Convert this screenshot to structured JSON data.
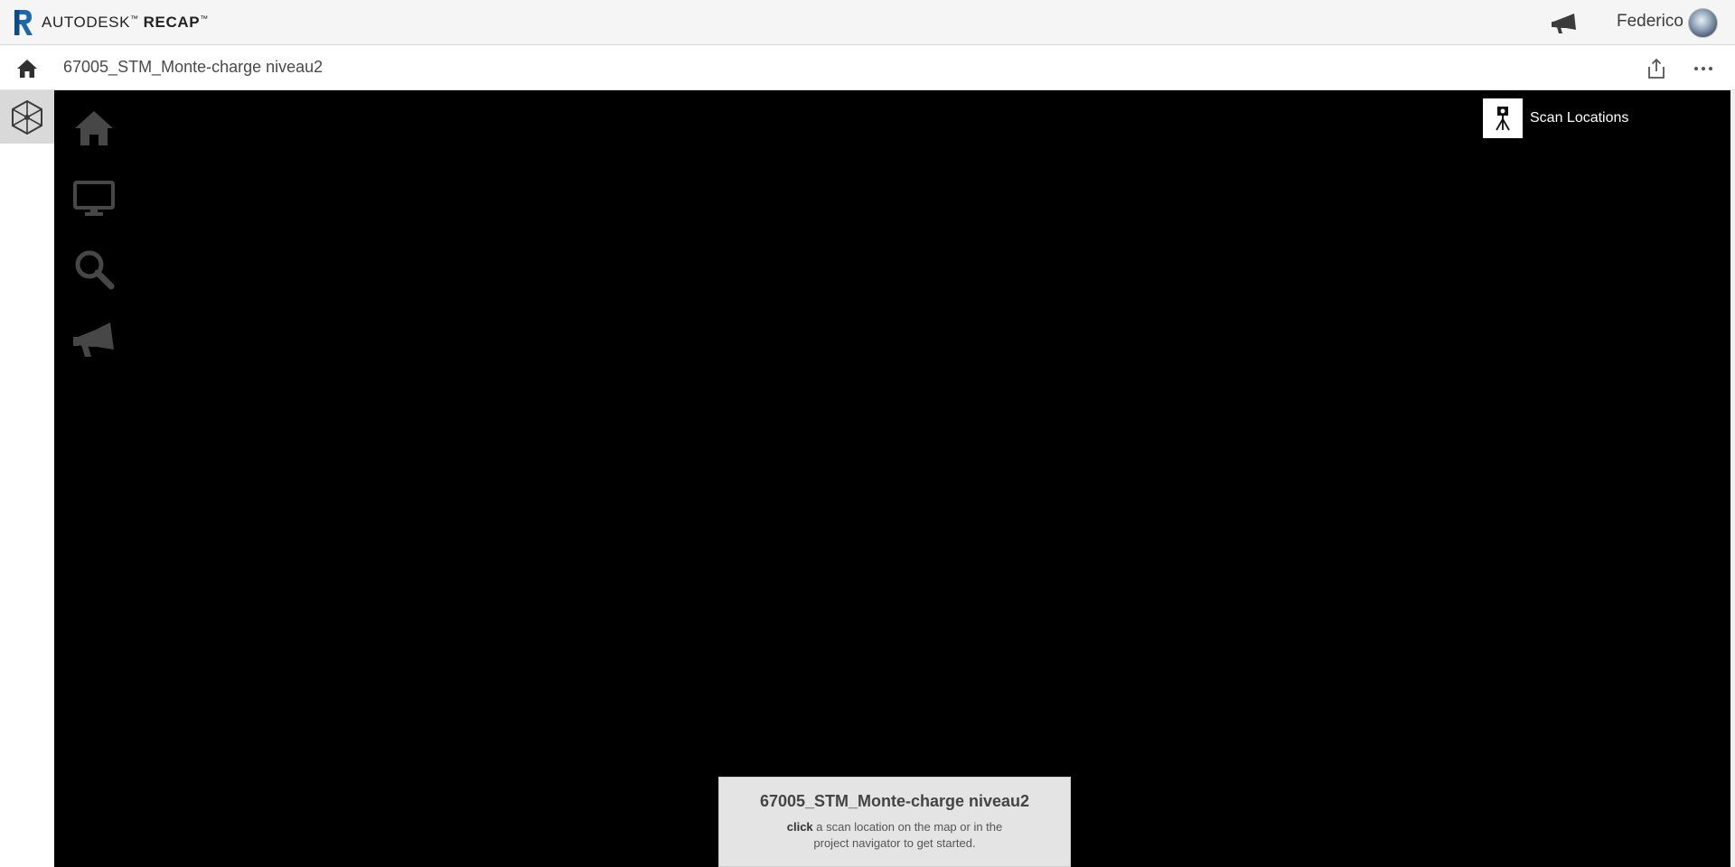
{
  "app": {
    "brand_name": "AUTODESK",
    "product_name": "RECAP",
    "trademark": "™",
    "logo_letter": "R"
  },
  "user": {
    "name": "Federico"
  },
  "project": {
    "title": "67005_STM_Monte-charge niveau2"
  },
  "left_rail": {
    "items": [
      {
        "icon": "3d-view-icon",
        "active": true
      }
    ]
  },
  "viewer": {
    "tools": [
      {
        "icon": "home-icon"
      },
      {
        "icon": "monitor-icon"
      },
      {
        "icon": "search-icon"
      },
      {
        "icon": "megaphone-icon"
      }
    ],
    "scan_locations": {
      "label": "Scan Locations",
      "icon": "scanner-tripod-icon"
    },
    "background": "#000000"
  },
  "info_panel": {
    "title": "67005_STM_Monte-charge niveau2",
    "body_bold": "click",
    "body_rest": " a scan location on the map or in the project navigator to get started."
  },
  "colors": {
    "topbar_bg": "#f5f5f5",
    "rail_active_bg": "#d9d9d9",
    "viewer_bg": "#000000",
    "viewer_tool": "#4a4a4a",
    "logo_blue": "#1b67b0",
    "info_bg": "#e4e4e4"
  }
}
